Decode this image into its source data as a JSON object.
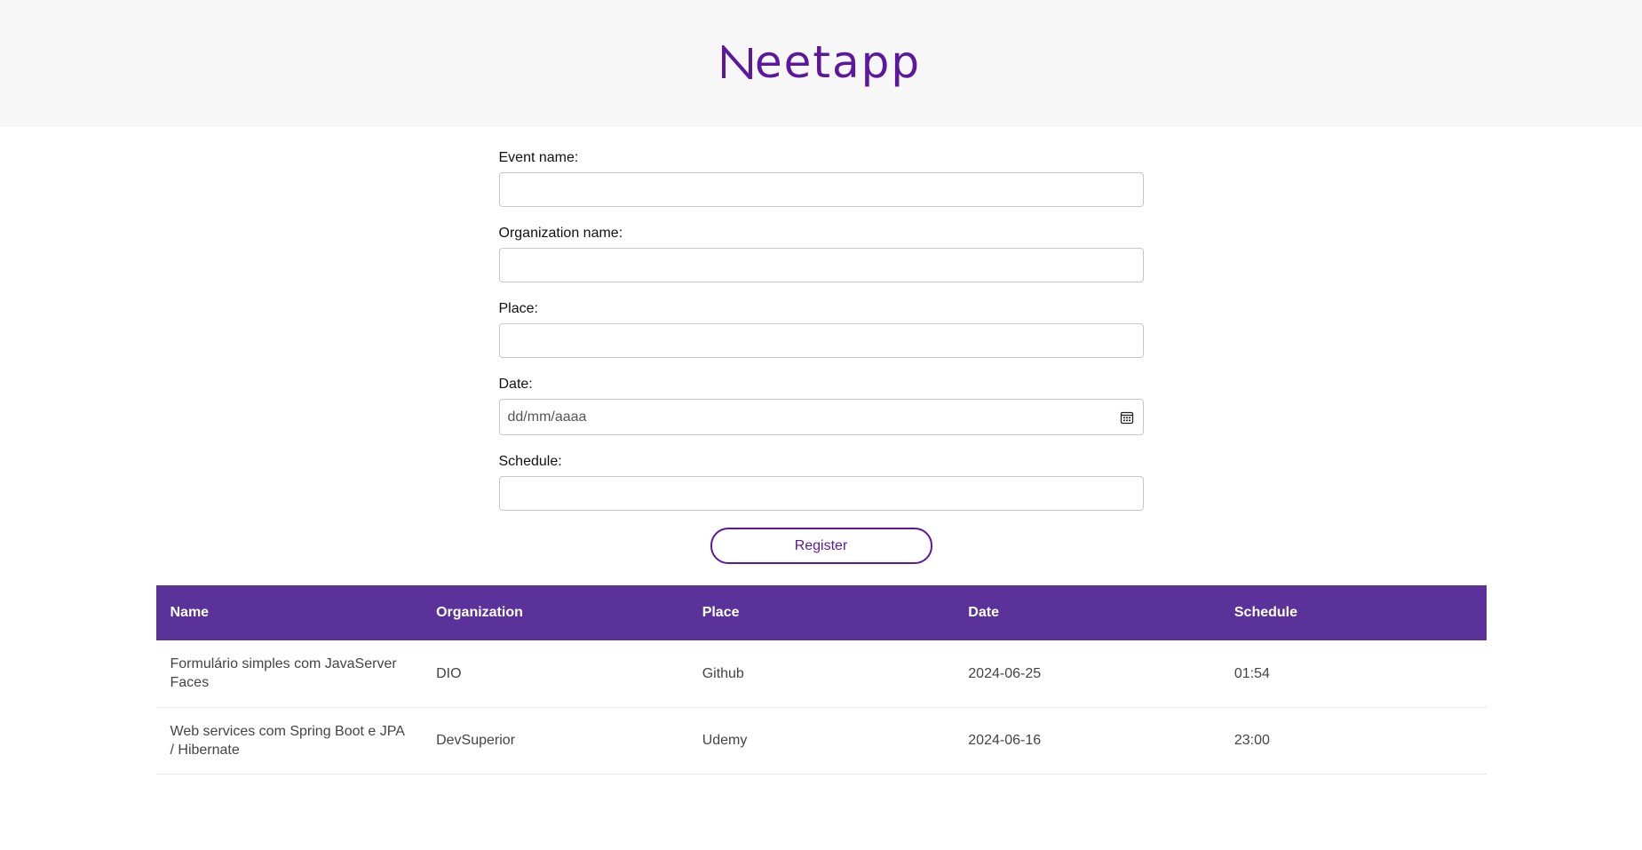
{
  "header": {
    "logo_text": "eetapp",
    "logo_color": "#5b189f"
  },
  "form": {
    "event_name_label": "Event name:",
    "event_name_value": "",
    "organization_name_label": "Organization name:",
    "organization_name_value": "",
    "place_label": "Place:",
    "place_value": "",
    "date_label": "Date:",
    "date_placeholder": "dd/mm/aaaa",
    "schedule_label": "Schedule:",
    "schedule_value": "",
    "register_label": "Register"
  },
  "table": {
    "header_color": "#5a3299",
    "columns": [
      "Name",
      "Organization",
      "Place",
      "Date",
      "Schedule"
    ],
    "rows": [
      [
        "Formulário simples com JavaServer Faces",
        "DIO",
        "Github",
        "2024-06-25",
        "01:54"
      ],
      [
        "Web services com Spring Boot e JPA / Hibernate",
        "DevSuperior",
        "Udemy",
        "2024-06-16",
        "23:00"
      ]
    ]
  }
}
